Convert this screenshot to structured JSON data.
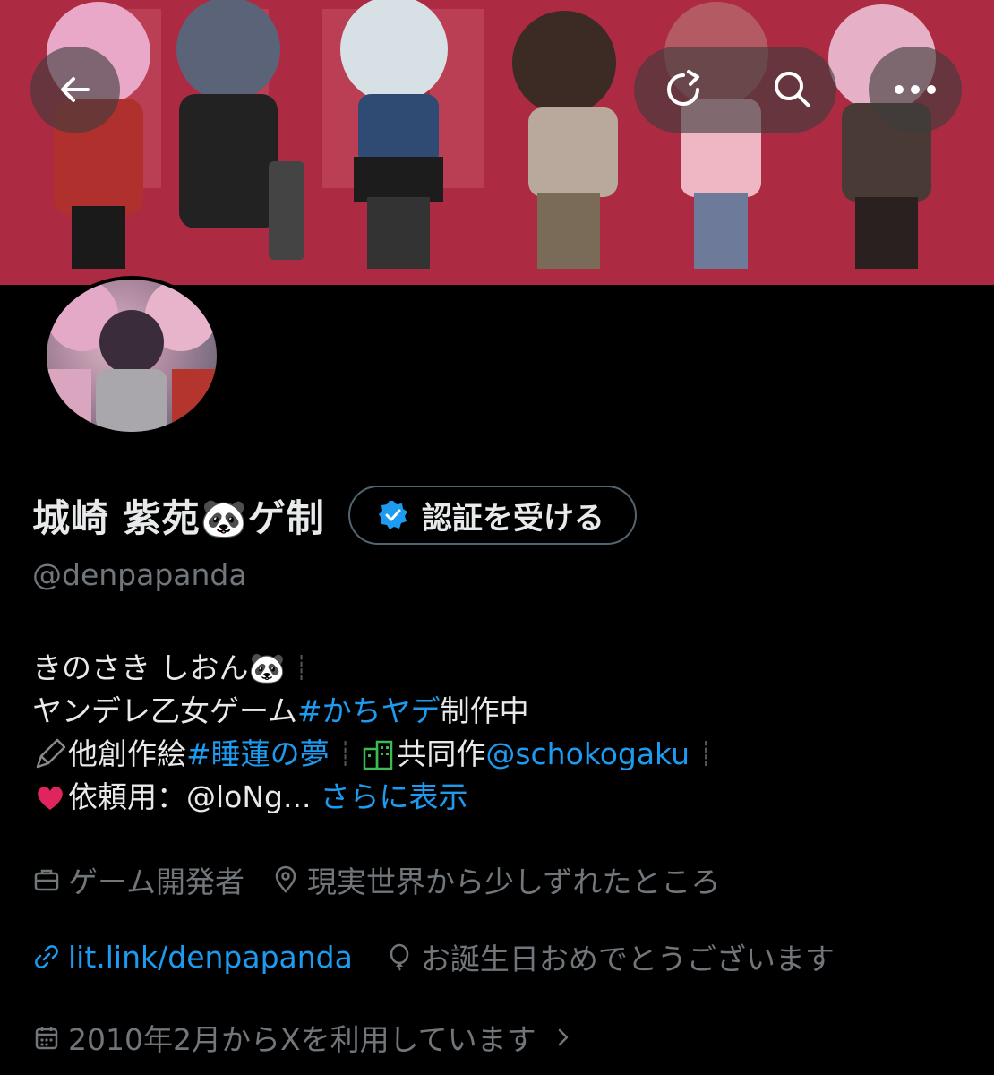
{
  "header": {
    "back_icon": "back-arrow-icon",
    "refresh_icon": "refresh-icon",
    "search_icon": "search-icon",
    "more_icon": "more-icon"
  },
  "profile": {
    "display_name": "城崎 紫苑🐼ゲ制",
    "verify_button": "認証を受ける",
    "handle": "@denpapanda"
  },
  "bio": {
    "line1": "きのさき しおん🐼",
    "line2_prefix": "ヤンデレ乙女ゲーム ",
    "line2_hashtag": "#かちヤデ",
    "line2_suffix": " 制作中",
    "line3_prefix": "他創作絵 ",
    "line3_hashtag": "#睡蓮の夢",
    "line3_mid": "共同作 ",
    "line3_mention": "@schokogaku",
    "line4_prefix": "依頼用：@loNg...",
    "line4_more": "さらに表示"
  },
  "meta": {
    "job": "ゲーム開発者",
    "location": "現実世界から少しずれたところ",
    "website": "lit.link/denpapanda",
    "birthday": "お誕生日おめでとうございます",
    "joined": "2010年2月からXを利用しています"
  },
  "colors": {
    "accent": "#1d9bf0",
    "muted": "#71767b",
    "banner": "#a8263e"
  }
}
